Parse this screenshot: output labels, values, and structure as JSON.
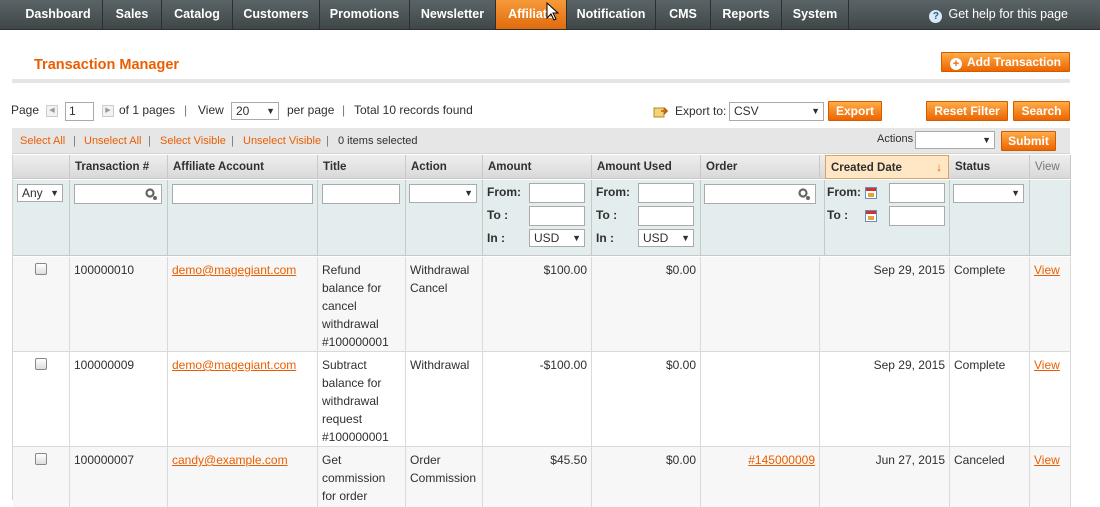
{
  "nav": {
    "items": [
      "Dashboard",
      "Sales",
      "Catalog",
      "Customers",
      "Promotions",
      "Newsletter",
      "Affiliate",
      "Notification",
      "CMS",
      "Reports",
      "System"
    ],
    "active": "Affiliate",
    "help": "Get help for this page"
  },
  "header": {
    "title": "Transaction Manager",
    "add_button": "Add Transaction"
  },
  "pager": {
    "page_label": "Page",
    "page_value": "1",
    "of_pages": "of 1 pages",
    "view_label": "View",
    "per_page_value": "20",
    "per_page_label": "per page",
    "total": "Total 10 records found",
    "export_label": "Export to:",
    "export_value": "CSV",
    "export_button": "Export",
    "reset_button": "Reset Filter",
    "search_button": "Search"
  },
  "massaction": {
    "select_all": "Select All",
    "unselect_all": "Unselect All",
    "select_visible": "Select Visible",
    "unselect_visible": "Unselect Visible",
    "selected": "0 items selected",
    "actions_label": "Actions",
    "submit": "Submit"
  },
  "grid": {
    "columns": [
      "",
      "Transaction #",
      "Affiliate Account",
      "Title",
      "Action",
      "Amount",
      "Amount Used",
      "Order",
      "Created Date",
      "Status",
      "View"
    ],
    "sort_indicator": "↓",
    "filters": {
      "any": "Any",
      "from": "From:",
      "to": "To :",
      "in": "In :",
      "currency": "USD"
    },
    "rows": [
      {
        "id": "100000010",
        "account": "demo@magegiant.com",
        "title": "Refund balance for cancel withdrawal #100000001",
        "action": "Withdrawal Cancel",
        "amount": "$100.00",
        "used": "$0.00",
        "order": "",
        "date": "Sep 29, 2015",
        "status": "Complete",
        "view": "View"
      },
      {
        "id": "100000009",
        "account": "demo@magegiant.com",
        "title": "Subtract balance for withdrawal request #100000001",
        "action": "Withdrawal",
        "amount": "-$100.00",
        "used": "$0.00",
        "order": "",
        "date": "Sep 29, 2015",
        "status": "Complete",
        "view": "View"
      },
      {
        "id": "100000007",
        "account": "candy@example.com",
        "title": "Get commission for order",
        "action": "Order Commission",
        "amount": "$45.50",
        "used": "$0.00",
        "order": "#145000009",
        "date": "Jun 27, 2015",
        "status": "Canceled",
        "view": "View"
      }
    ]
  },
  "colors": {
    "accent": "#eb5e00",
    "nav_bg": "#4a5355",
    "filter_bg": "#e3eded"
  }
}
